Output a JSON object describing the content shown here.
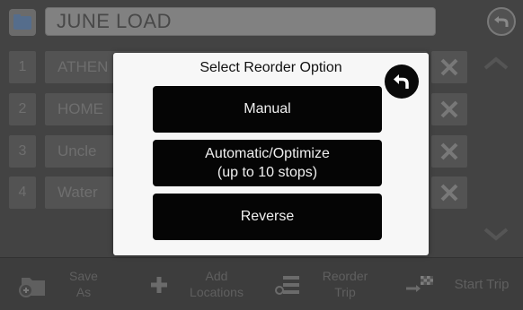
{
  "header": {
    "title": "JUNE LOAD",
    "folder_icon": "folder-icon",
    "back_icon": "back-arrow-icon"
  },
  "stops": [
    {
      "number": "1",
      "name": "ATHEN"
    },
    {
      "number": "2",
      "name": "HOME"
    },
    {
      "number": "3",
      "name": "Uncle"
    },
    {
      "number": "4",
      "name": "Water"
    }
  ],
  "bottom_bar": {
    "save_as": {
      "line1": "Save",
      "line2": "As"
    },
    "add_locations": {
      "line1": "Add",
      "line2": "Locations"
    },
    "reorder_trip": {
      "line1": "Reorder",
      "line2": "Trip"
    },
    "start_trip": "Start Trip"
  },
  "dialog": {
    "title": "Select Reorder Option",
    "options": {
      "manual": "Manual",
      "automatic_line1": "Automatic/Optimize",
      "automatic_line2": "(up to 10 stops)",
      "reverse": "Reverse"
    }
  },
  "colors": {
    "background": "#575757",
    "row": "#6b6b6b",
    "dialog": "#f7f7f7",
    "option_button": "#050505"
  }
}
